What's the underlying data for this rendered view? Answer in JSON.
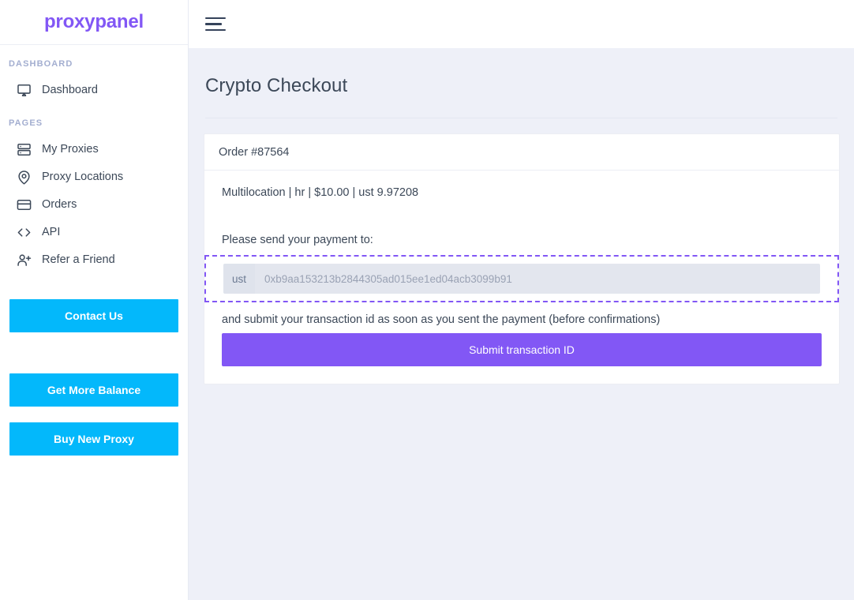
{
  "sidebar": {
    "brand": "proxypanel",
    "groups": [
      {
        "label": "DASHBOARD",
        "items": [
          {
            "label": "Dashboard",
            "icon": "monitor-icon"
          }
        ]
      },
      {
        "label": "PAGES",
        "items": [
          {
            "label": "My Proxies",
            "icon": "server-icon"
          },
          {
            "label": "Proxy Locations",
            "icon": "map-pin-icon"
          },
          {
            "label": "Orders",
            "icon": "credit-card-icon"
          },
          {
            "label": "API",
            "icon": "code-icon"
          },
          {
            "label": "Refer a Friend",
            "icon": "user-plus-icon"
          }
        ]
      }
    ],
    "buttons": {
      "contact": "Contact Us",
      "balance": "Get More Balance",
      "buy": "Buy New Proxy"
    }
  },
  "topbar": {
    "menu_icon": "hamburger-icon"
  },
  "page": {
    "title": "Crypto Checkout"
  },
  "order": {
    "header": "Order #87564",
    "summary": "Multilocation | hr | $10.00 | ust 9.97208",
    "send_label": "Please send your payment to:",
    "currency_prefix": "ust",
    "address_placeholder": "0xb9aa153213b2844305ad015ee1ed04acb3099b91",
    "address_value": "",
    "submit_note": "and submit your transaction id as soon as you sent the payment (before confirmations)",
    "submit_label": "Submit transaction ID"
  },
  "colors": {
    "brand_purple": "#8257f5",
    "button_cyan": "#03b8fb",
    "page_bg": "#eef0f8",
    "text": "#3c4858",
    "muted": "#a3aed0"
  }
}
